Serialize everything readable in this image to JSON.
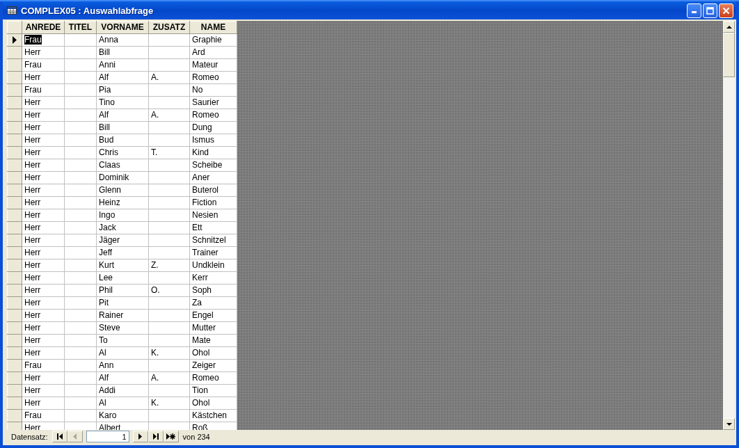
{
  "window": {
    "title": "COMPLEX05 : Auswahlabfrage"
  },
  "table": {
    "columns": [
      "ANREDE",
      "TITEL",
      "VORNAME",
      "ZUSATZ",
      "NAME"
    ],
    "rows": [
      {
        "selected": true,
        "cells": [
          "Frau",
          "",
          "Anna",
          "",
          "Graphie"
        ]
      },
      {
        "selected": false,
        "cells": [
          "Herr",
          "",
          "Bill",
          "",
          "Ard"
        ]
      },
      {
        "selected": false,
        "cells": [
          "Frau",
          "",
          "Anni",
          "",
          "Mateur"
        ]
      },
      {
        "selected": false,
        "cells": [
          "Herr",
          "",
          "Alf",
          "A.",
          "Romeo"
        ]
      },
      {
        "selected": false,
        "cells": [
          "Frau",
          "",
          "Pia",
          "",
          "No"
        ]
      },
      {
        "selected": false,
        "cells": [
          "Herr",
          "",
          "Tino",
          "",
          "Saurier"
        ]
      },
      {
        "selected": false,
        "cells": [
          "Herr",
          "",
          "Alf",
          "A.",
          "Romeo"
        ]
      },
      {
        "selected": false,
        "cells": [
          "Herr",
          "",
          "Bill",
          "",
          "Dung"
        ]
      },
      {
        "selected": false,
        "cells": [
          "Herr",
          "",
          "Bud",
          "",
          "Ismus"
        ]
      },
      {
        "selected": false,
        "cells": [
          "Herr",
          "",
          "Chris",
          "T.",
          "Kind"
        ]
      },
      {
        "selected": false,
        "cells": [
          "Herr",
          "",
          "Claas",
          "",
          "Scheibe"
        ]
      },
      {
        "selected": false,
        "cells": [
          "Herr",
          "",
          "Dominik",
          "",
          "Aner"
        ]
      },
      {
        "selected": false,
        "cells": [
          "Herr",
          "",
          "Glenn",
          "",
          "Buterol"
        ]
      },
      {
        "selected": false,
        "cells": [
          "Herr",
          "",
          "Heinz",
          "",
          "Fiction"
        ]
      },
      {
        "selected": false,
        "cells": [
          "Herr",
          "",
          "Ingo",
          "",
          "Nesien"
        ]
      },
      {
        "selected": false,
        "cells": [
          "Herr",
          "",
          "Jack",
          "",
          "Ett"
        ]
      },
      {
        "selected": false,
        "cells": [
          "Herr",
          "",
          "Jäger",
          "",
          "Schnitzel"
        ]
      },
      {
        "selected": false,
        "cells": [
          "Herr",
          "",
          "Jeff",
          "",
          "Trainer"
        ]
      },
      {
        "selected": false,
        "cells": [
          "Herr",
          "",
          "Kurt",
          "Z.",
          "Undklein"
        ]
      },
      {
        "selected": false,
        "cells": [
          "Herr",
          "",
          "Lee",
          "",
          "Kerr"
        ]
      },
      {
        "selected": false,
        "cells": [
          "Herr",
          "",
          "Phil",
          "O.",
          "Soph"
        ]
      },
      {
        "selected": false,
        "cells": [
          "Herr",
          "",
          "Pit",
          "",
          "Za"
        ]
      },
      {
        "selected": false,
        "cells": [
          "Herr",
          "",
          "Rainer",
          "",
          "Engel"
        ]
      },
      {
        "selected": false,
        "cells": [
          "Herr",
          "",
          "Steve",
          "",
          "Mutter"
        ]
      },
      {
        "selected": false,
        "cells": [
          "Herr",
          "",
          "To",
          "",
          "Mate"
        ]
      },
      {
        "selected": false,
        "cells": [
          "Herr",
          "",
          "Al",
          "K.",
          "Ohol"
        ]
      },
      {
        "selected": false,
        "cells": [
          "Frau",
          "",
          "Ann",
          "",
          "Zeiger"
        ]
      },
      {
        "selected": false,
        "cells": [
          "Herr",
          "",
          "Alf",
          "A.",
          "Romeo"
        ]
      },
      {
        "selected": false,
        "cells": [
          "Herr",
          "",
          "Addi",
          "",
          "Tion"
        ]
      },
      {
        "selected": false,
        "cells": [
          "Herr",
          "",
          "Al",
          "K.",
          "Ohol"
        ]
      },
      {
        "selected": false,
        "cells": [
          "Frau",
          "",
          "Karo",
          "",
          "Kästchen"
        ]
      },
      {
        "selected": false,
        "cells": [
          "Herr",
          "",
          "Albert",
          "",
          "Roß"
        ]
      }
    ]
  },
  "navigation": {
    "label": "Datensatz:",
    "record": "1",
    "total": "von 234",
    "buttons": [
      {
        "kind": "first",
        "disabled": false
      },
      {
        "kind": "prev",
        "disabled": true
      }
    ],
    "buttons_after": [
      {
        "kind": "next",
        "disabled": false
      },
      {
        "kind": "last",
        "disabled": false
      },
      {
        "kind": "new",
        "disabled": false
      }
    ]
  }
}
